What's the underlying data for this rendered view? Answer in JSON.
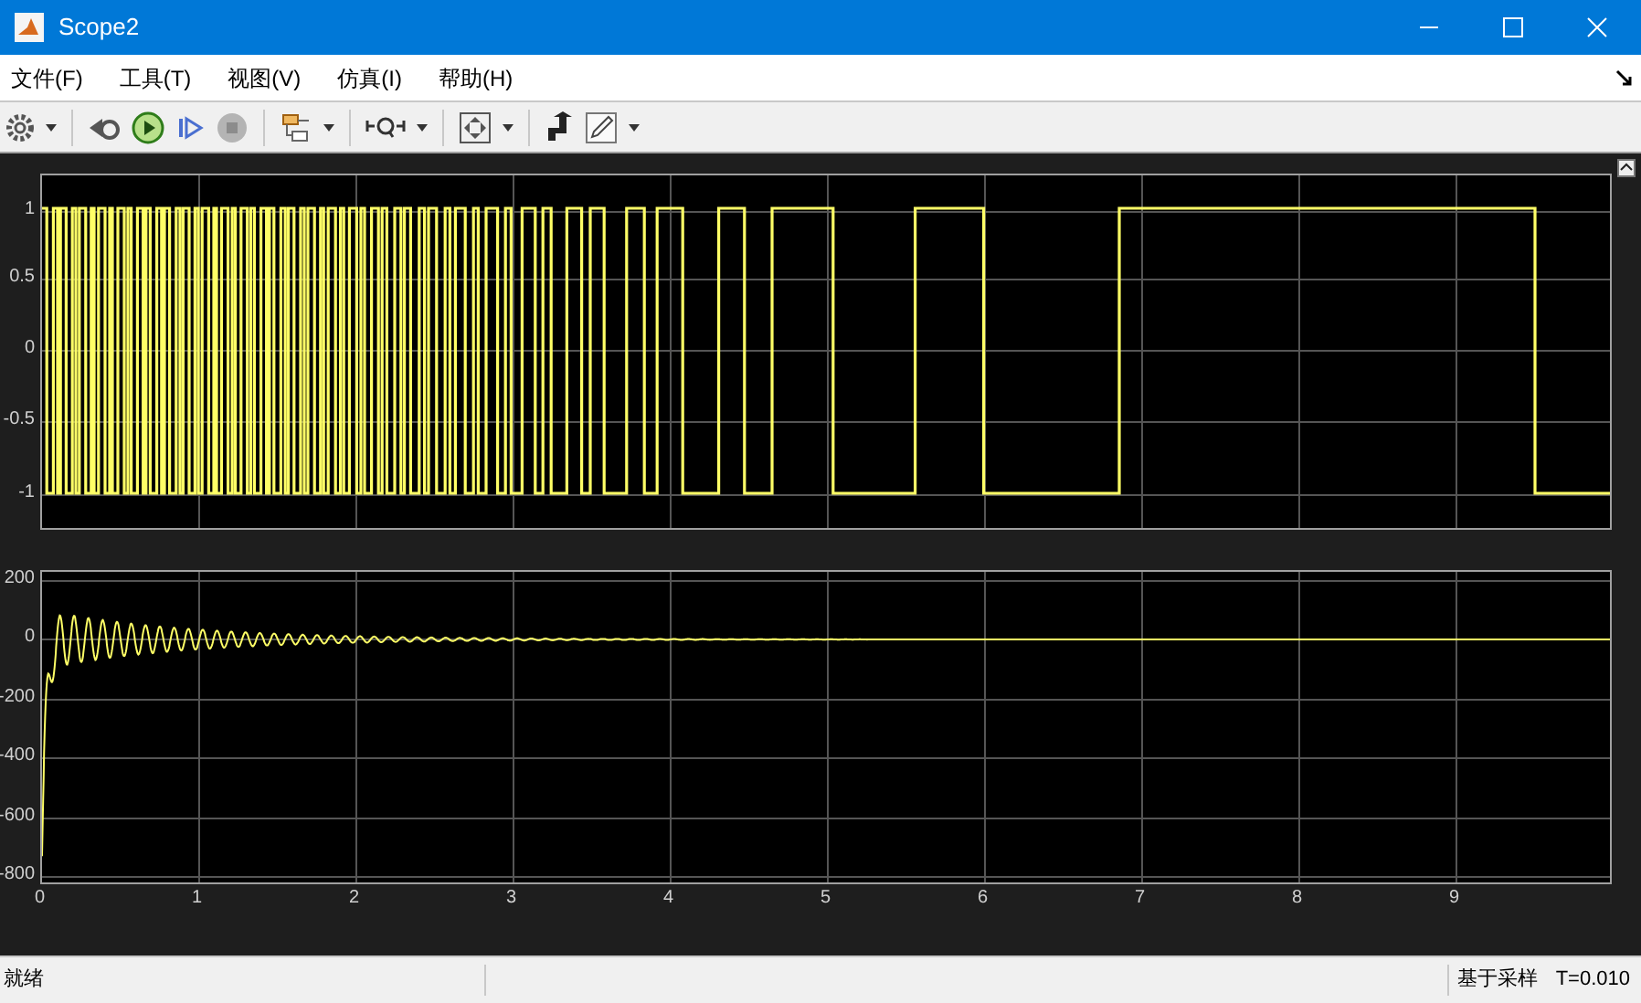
{
  "window": {
    "title": "Scope2"
  },
  "menu": [
    {
      "label": "文件(F)"
    },
    {
      "label": "工具(T)"
    },
    {
      "label": "视图(V)"
    },
    {
      "label": "仿真(I)"
    },
    {
      "label": "帮助(H)"
    }
  ],
  "toolbar": [
    {
      "kind": "settings"
    },
    {
      "kind": "dropdown"
    },
    {
      "kind": "separator"
    },
    {
      "kind": "step-back"
    },
    {
      "kind": "run"
    },
    {
      "kind": "step-forward"
    },
    {
      "kind": "stop"
    },
    {
      "kind": "separator"
    },
    {
      "kind": "blocks"
    },
    {
      "kind": "dropdown"
    },
    {
      "kind": "separator"
    },
    {
      "kind": "zoom"
    },
    {
      "kind": "dropdown"
    },
    {
      "kind": "separator"
    },
    {
      "kind": "fit"
    },
    {
      "kind": "dropdown"
    },
    {
      "kind": "separator"
    },
    {
      "kind": "highlight"
    },
    {
      "kind": "style"
    },
    {
      "kind": "dropdown"
    }
  ],
  "plots": [
    {
      "kind": "pulse",
      "yticks": [
        "1",
        "0.5",
        "0",
        "-0.5",
        "-1"
      ]
    },
    {
      "kind": "damped",
      "yticks": [
        "200",
        "0",
        "-200",
        "-400",
        "-600",
        "-800"
      ]
    }
  ],
  "xticks": [
    "0",
    "1",
    "2",
    "3",
    "4",
    "5",
    "6",
    "7",
    "8",
    "9"
  ],
  "status_bar": {
    "text": "就绪",
    "mode": "基于采样",
    "time": "T=0.010"
  }
}
